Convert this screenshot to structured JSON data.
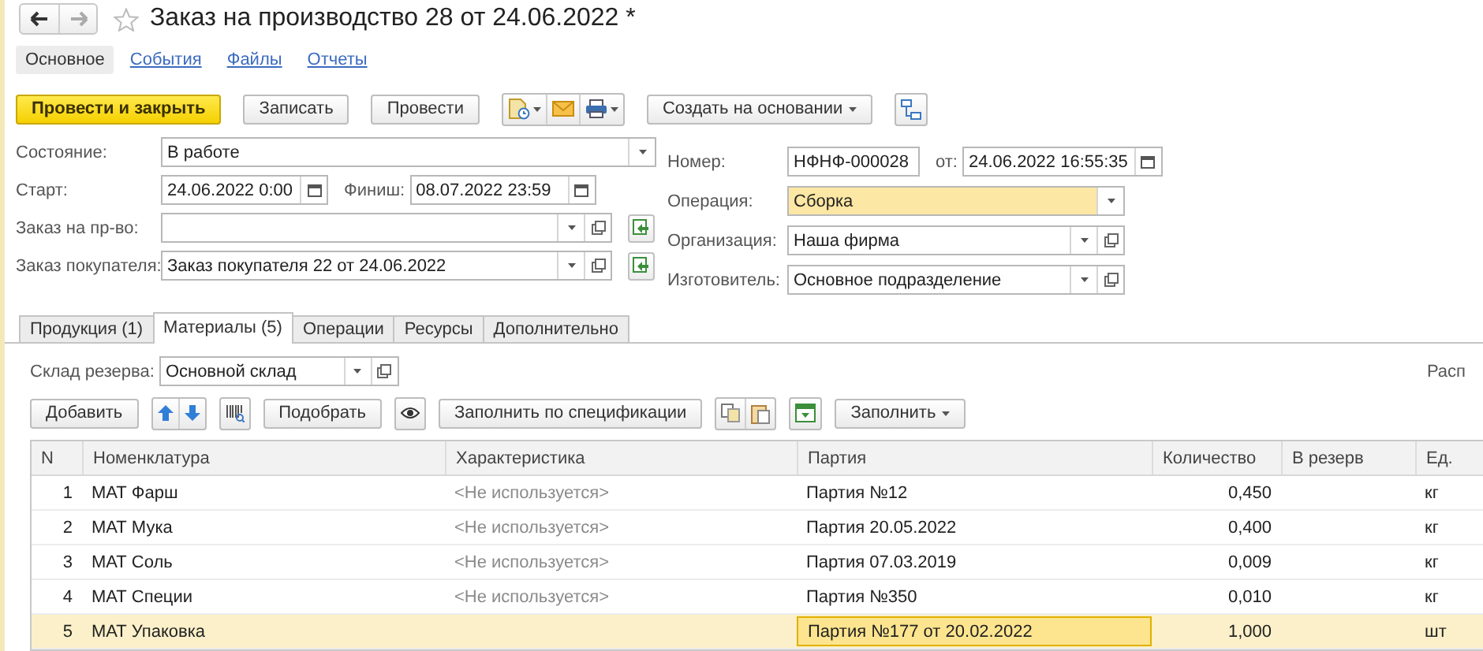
{
  "nav_buttons": [
    {
      "kind": "back",
      "disabled": false
    },
    {
      "kind": "forward",
      "disabled": true
    }
  ],
  "favorite": false,
  "title": "Заказ на производство 28 от 24.06.2022 *",
  "sections": [
    {
      "label": "Основное",
      "selected": true
    },
    {
      "label": "События",
      "selected": false
    },
    {
      "label": "Файлы",
      "selected": false
    },
    {
      "label": "Отчеты",
      "selected": false
    }
  ],
  "toolbar": [
    {
      "kind": "primary",
      "label": "Провести и закрыть"
    },
    {
      "kind": "button",
      "label": "Записать"
    },
    {
      "kind": "button",
      "label": "Провести"
    },
    {
      "kind": "icon-group",
      "icons": [
        {
          "kind": "document-menu"
        },
        {
          "kind": "mail"
        },
        {
          "kind": "print-menu"
        }
      ]
    },
    {
      "kind": "menu-button",
      "label": "Создать на основании"
    },
    {
      "kind": "icon-group",
      "icons": [
        {
          "kind": "structure"
        }
      ]
    }
  ],
  "fields_left": [
    {
      "kind": "select",
      "label": "Состояние:",
      "value": "В работе",
      "highlighted": false,
      "controls": [
        {
          "kind": "dropdown"
        }
      ],
      "fill_button": false
    },
    {
      "kind": "dates",
      "label": "Старт:",
      "value": "24.06.2022  0:00",
      "second_label": "Финиш:",
      "second_value": "08.07.2022 23:59"
    },
    {
      "kind": "select",
      "label": "Заказ на пр-во:",
      "highlighted": false,
      "controls": [
        {
          "kind": "dropdown"
        },
        {
          "kind": "open"
        }
      ],
      "fill_button": true
    },
    {
      "kind": "select",
      "label": "Заказ покупателя:",
      "value": "Заказ покупателя 22 от 24.06.2022",
      "highlighted": false,
      "controls": [
        {
          "kind": "dropdown"
        },
        {
          "kind": "open"
        }
      ],
      "fill_button": true
    }
  ],
  "fields_right": [
    {
      "kind": "number",
      "label": "Номер:",
      "value": "НФНФ-000028",
      "second_label": "от:",
      "second_value": "24.06.2022 16:55:35"
    },
    {
      "kind": "select",
      "label": "Операция:",
      "value": "Сборка",
      "highlighted": true,
      "controls": [
        {
          "kind": "dropdown"
        }
      ],
      "fill_button": false
    },
    {
      "kind": "select",
      "label": "Организация:",
      "value": "Наша фирма",
      "highlighted": false,
      "controls": [
        {
          "kind": "dropdown"
        },
        {
          "kind": "open"
        }
      ],
      "fill_button": false
    },
    {
      "kind": "select",
      "label": "Изготовитель:",
      "value": "Основное подразделение",
      "highlighted": false,
      "controls": [
        {
          "kind": "dropdown"
        },
        {
          "kind": "open"
        }
      ],
      "fill_button": false
    }
  ],
  "tabs": [
    {
      "label": "Продукция (1)",
      "selected": false
    },
    {
      "label": "Материалы (5)",
      "selected": true
    },
    {
      "label": "Операции",
      "selected": false
    },
    {
      "label": "Ресурсы",
      "selected": false
    },
    {
      "label": "Дополнительно",
      "selected": false
    }
  ],
  "warehouse": {
    "label": "Склад резерва:",
    "value": "Основной склад"
  },
  "right_caption": "Расп",
  "table_toolbar": [
    {
      "kind": "button",
      "label": "Добавить"
    },
    {
      "kind": "icon-group",
      "icons": [
        {
          "kind": "up"
        },
        {
          "kind": "down"
        }
      ]
    },
    {
      "kind": "icon-group",
      "icons": [
        {
          "kind": "barcode"
        }
      ]
    },
    {
      "kind": "button",
      "label": "Подобрать"
    },
    {
      "kind": "icon-group",
      "icons": [
        {
          "kind": "eye"
        }
      ]
    },
    {
      "kind": "button",
      "label": "Заполнить по спецификации"
    },
    {
      "kind": "icon-group",
      "icons": [
        {
          "kind": "copy"
        },
        {
          "kind": "paste"
        }
      ]
    },
    {
      "kind": "icon-group",
      "icons": [
        {
          "kind": "fill-green"
        }
      ]
    },
    {
      "kind": "menu-button",
      "label": "Заполнить"
    }
  ],
  "table": {
    "columns": [
      "N",
      "Номенклатура",
      "Характеристика",
      "Партия",
      "Количество",
      "В резерв",
      "Ед."
    ],
    "rows": [
      {
        "n": "1",
        "item": "МАТ Фарш",
        "characteristic": "<Не используется>",
        "batch": "Партия №12",
        "quantity": "0,450",
        "unit": "кг",
        "selected": false,
        "batch_focused": false
      },
      {
        "n": "2",
        "item": "МАТ Мука",
        "characteristic": "<Не используется>",
        "batch": "Партия 20.05.2022",
        "quantity": "0,400",
        "unit": "кг",
        "selected": false,
        "batch_focused": false
      },
      {
        "n": "3",
        "item": "МАТ Соль",
        "characteristic": "<Не используется>",
        "batch": "Партия 07.03.2019",
        "quantity": "0,009",
        "unit": "кг",
        "selected": false,
        "batch_focused": false
      },
      {
        "n": "4",
        "item": "МАТ Специи",
        "characteristic": "<Не используется>",
        "batch": "Партия №350",
        "quantity": "0,010",
        "unit": "кг",
        "selected": false,
        "batch_focused": false
      },
      {
        "n": "5",
        "item": "МАТ Упаковка",
        "batch": "Партия №177 от 20.02.2022",
        "quantity": "1,000",
        "unit": "шт",
        "selected": true,
        "batch_focused": true
      }
    ]
  }
}
